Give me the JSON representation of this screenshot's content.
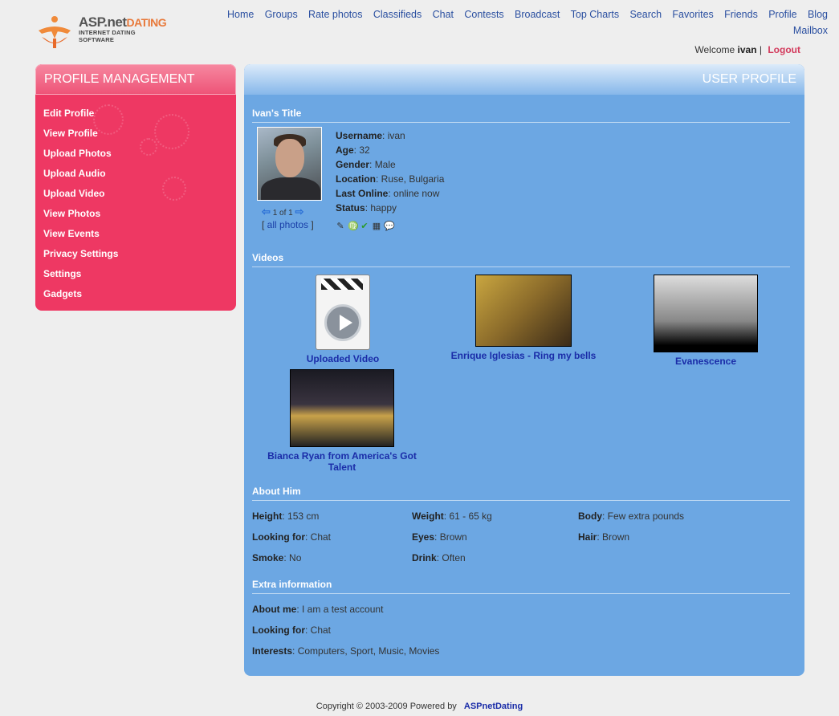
{
  "logo": {
    "brand": "ASP.net",
    "brand_accent": "DATING",
    "subtitle": "INTERNET DATING SOFTWARE"
  },
  "nav": {
    "items": [
      "Home",
      "Groups",
      "Rate photos",
      "Classifieds",
      "Chat",
      "Contests",
      "Broadcast",
      "Top Charts",
      "Search",
      "Favorites",
      "Friends",
      "Profile",
      "Blog"
    ],
    "mailbox": "Mailbox"
  },
  "welcome": {
    "text": "Welcome",
    "user": "ivan",
    "separator": "|",
    "logout": "Logout"
  },
  "sidebar": {
    "title": "PROFILE MANAGEMENT",
    "items": [
      "Edit Profile",
      "View Profile",
      "Upload Photos",
      "Upload Audio",
      "Upload Video",
      "View Photos",
      "View Events",
      "Privacy Settings",
      "Settings",
      "Gadgets"
    ]
  },
  "main": {
    "title": "USER PROFILE",
    "profile_title": "Ivan's Title",
    "pager": "1 of 1",
    "all_photos": "all photos",
    "info": [
      {
        "label": "Username",
        "value": "ivan"
      },
      {
        "label": "Age",
        "value": "32"
      },
      {
        "label": "Gender",
        "value": "Male"
      },
      {
        "label": "Location",
        "value": "Ruse, Bulgaria"
      },
      {
        "label": "Last Online",
        "value": "online now"
      },
      {
        "label": "Status",
        "value": "happy"
      }
    ],
    "videos_title": "Videos",
    "videos": [
      "Uploaded Video",
      "Enrique Iglesias - Ring my bells",
      "Evanescence",
      "Bianca Ryan from America's Got Talent"
    ],
    "about_title": "About Him",
    "about": [
      {
        "label": "Height",
        "value": "153 cm"
      },
      {
        "label": "Weight",
        "value": "61 - 65 kg"
      },
      {
        "label": "Body",
        "value": "Few extra pounds"
      },
      {
        "label": "Looking for",
        "value": "Chat"
      },
      {
        "label": "Eyes",
        "value": "Brown"
      },
      {
        "label": "Hair",
        "value": "Brown"
      },
      {
        "label": "Smoke",
        "value": "No"
      },
      {
        "label": "Drink",
        "value": "Often"
      }
    ],
    "extra_title": "Extra information",
    "extra": [
      {
        "label": "About me",
        "value": "I am a test account"
      },
      {
        "label": "Looking for",
        "value": "Chat"
      },
      {
        "label": "Interests",
        "value": "Computers, Sport, Music, Movies"
      }
    ]
  },
  "footer": {
    "text": "Copyright © 2003-2009 Powered by",
    "link": "ASPnetDating"
  }
}
